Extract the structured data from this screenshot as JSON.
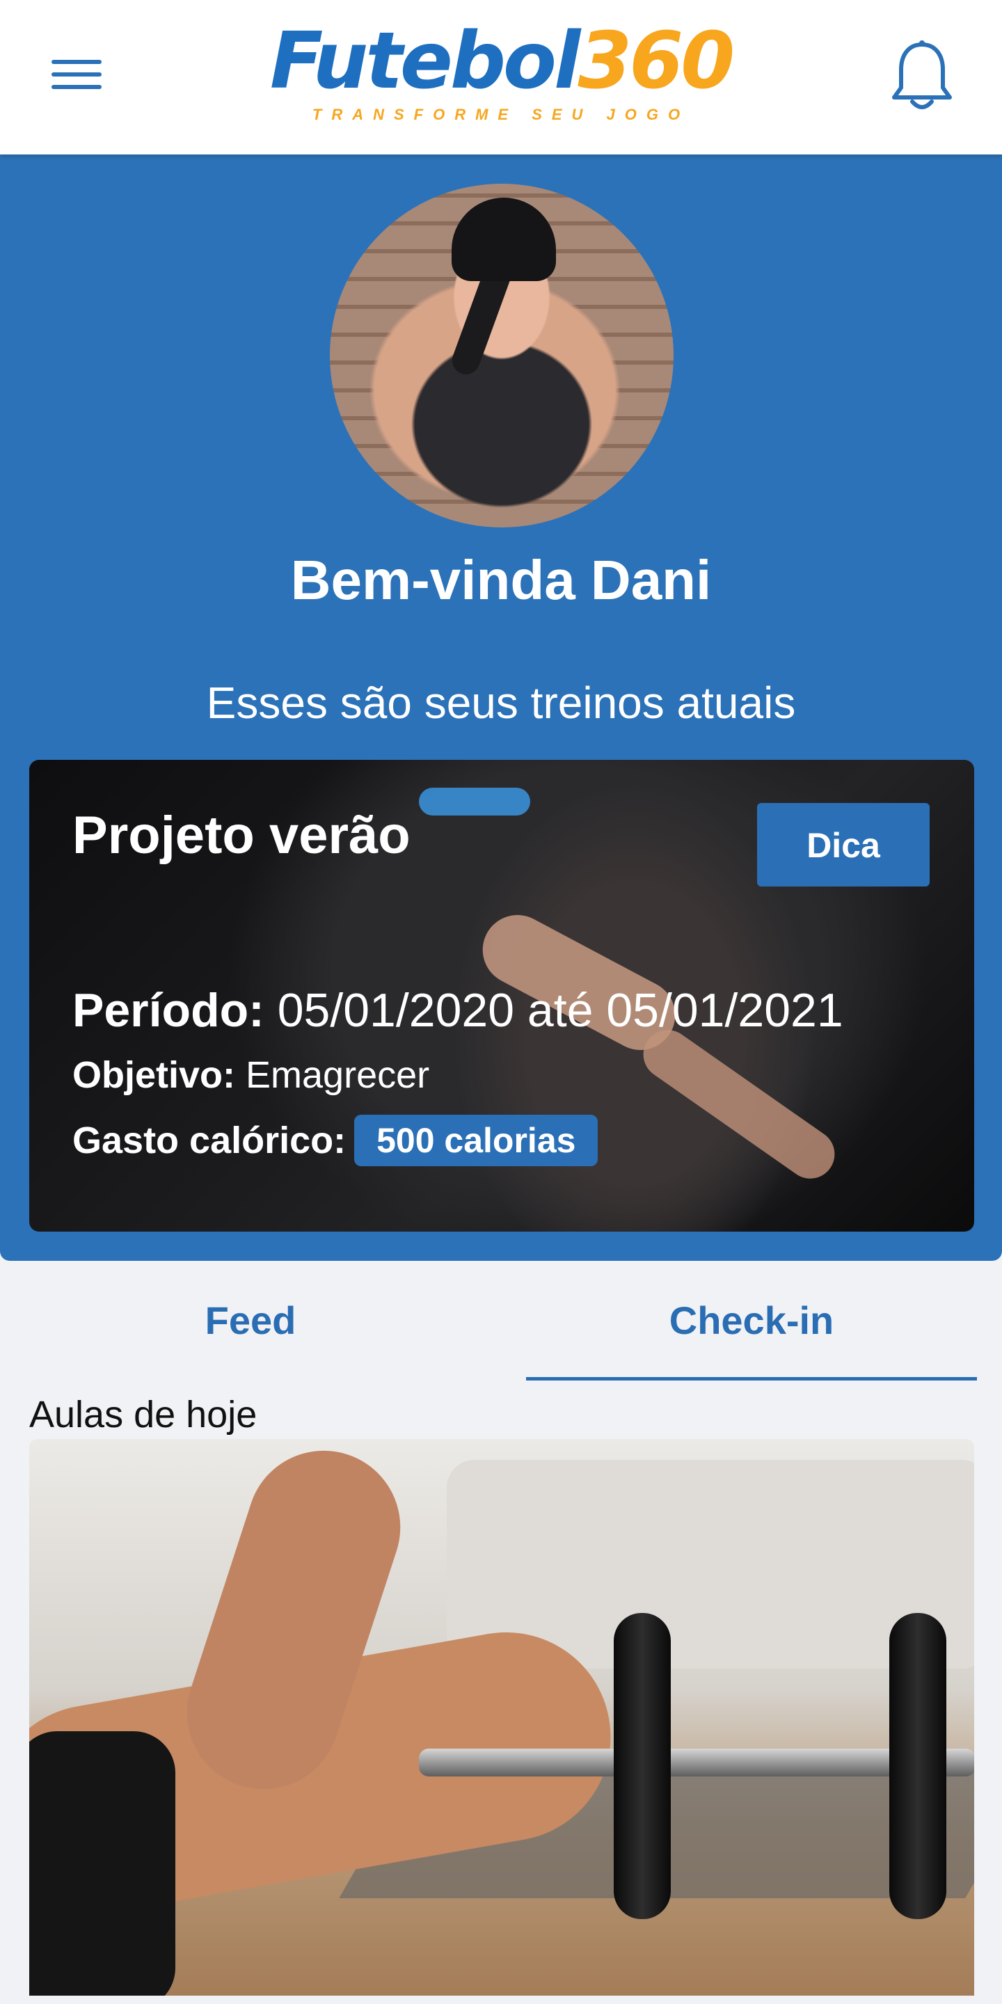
{
  "header": {
    "menu_icon": "hamburger-menu-icon",
    "logo": {
      "word": "Futebol",
      "number": "360",
      "tagline": "TRANSFORME SEU JOGO"
    },
    "notification_icon": "bell-icon"
  },
  "hero": {
    "avatar": "profile-photo",
    "welcome": "Bem-vinda Dani",
    "subtitle": "Esses são seus treinos atuais"
  },
  "plan": {
    "title": "Projeto verão",
    "tip_button": "Dica",
    "period_label": "Período:",
    "period_value": " 05/01/2020 até 05/01/2021",
    "goal_label": "Objetivo:",
    "goal_value": " Emagrecer",
    "calories_label": "Gasto calórico:",
    "calories_value": "500 calorias"
  },
  "tabs": [
    {
      "label": "Feed",
      "active": false
    },
    {
      "label": "Check-in",
      "active": true
    }
  ],
  "classes": {
    "section_label": "Aulas de hoje"
  },
  "colors": {
    "brand_blue": "#2c72b9",
    "accent_orange": "#f7a61e",
    "tab_blue": "#2a6db3",
    "background": "#f0f2f6"
  }
}
